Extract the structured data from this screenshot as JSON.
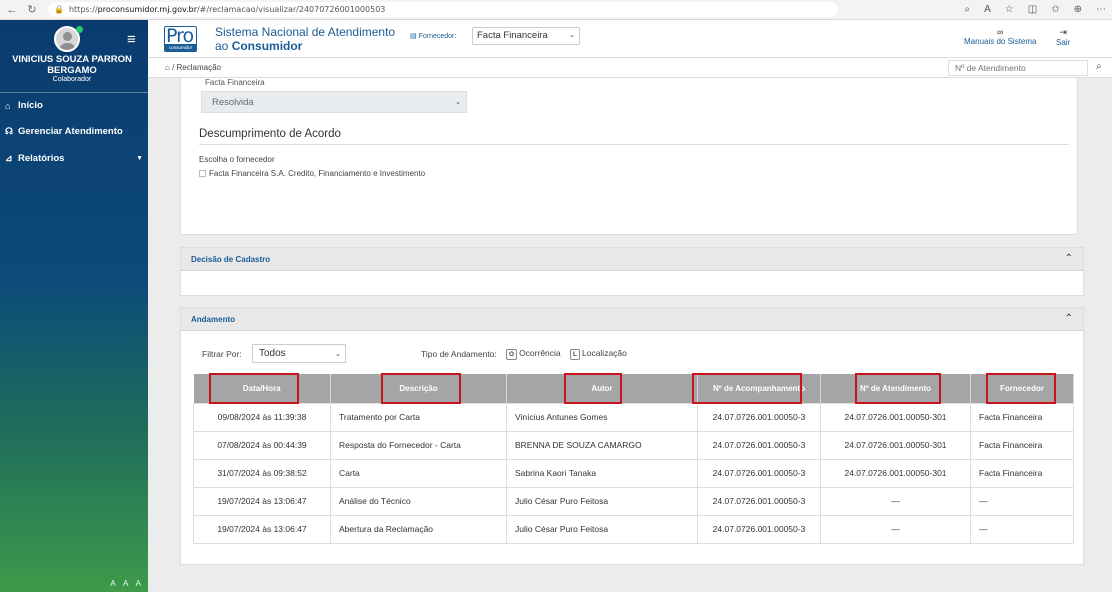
{
  "browser": {
    "url_prefix": "https://",
    "url_domain": "proconsumidor.mj.gov.br",
    "url_path": "/#/reclamacao/visualizar/24070726001000503"
  },
  "sidebar": {
    "user_name": "VINICIUS SOUZA PARRON BERGAMO",
    "user_role": "Colaborador",
    "items": [
      {
        "label": "Início",
        "icon": "home-icon"
      },
      {
        "label": "Gerenciar Atendimento",
        "icon": "headset-icon"
      },
      {
        "label": "Relatórios",
        "icon": "chart-icon"
      }
    ],
    "font_controls": "A A A"
  },
  "header": {
    "logo_text": "Pro",
    "logo_sub": "consumidor",
    "title_line1": "Sistema Nacional de Atendimento",
    "title_line2_prefix": "ao ",
    "title_line2_bold": "Consumidor",
    "fornecedor_label": "Fornecedor:",
    "fornecedor_value": "Facta Financeira",
    "manuals_label": "Manuais do Sistema",
    "exit_label": "Sair"
  },
  "breadcrumb": {
    "current": "Reclamação"
  },
  "search": {
    "placeholder": "Nº de Atendimento"
  },
  "top_card": {
    "fornecedor_small": "Facta Financeira",
    "status_value": "Resolvida",
    "section_title": "Descumprimento de Acordo",
    "choose_label": "Escolha o fornecedor",
    "checkbox_label": "Facta Financeira S.A. Credito, Financiamento e Investimento"
  },
  "decisao": {
    "title": "Decisão de Cadastro"
  },
  "andamento": {
    "title": "Andamento",
    "filter_label": "Filtrar Por:",
    "filter_value": "Todos",
    "tipo_label": "Tipo de Andamento:",
    "tipo_o_badge": "O",
    "tipo_o_label": "Ocorrência",
    "tipo_l_badge": "L",
    "tipo_l_label": "Localização",
    "columns": [
      "Data/Hora",
      "Descrição",
      "Autor",
      "Nº de Acompanhamento",
      "Nº de Atendimento",
      "Fornecedor"
    ],
    "rows": [
      [
        "09/08/2024 às 11:39:38",
        "Tratamento por Carta",
        "Vinícius Antunes Gomes",
        "24.07.0726.001.00050-3",
        "24.07.0726.001.00050-301",
        "Facta Financeira"
      ],
      [
        "07/08/2024 às 00:44:39",
        "Resposta do Fornecedor - Carta",
        "BRENNA DE SOUZA CAMARGO",
        "24.07.0726.001.00050-3",
        "24.07.0726.001.00050-301",
        "Facta Financeira"
      ],
      [
        "31/07/2024 às 09:38:52",
        "Carta",
        "Sabrina Kaori Tanaka",
        "24.07.0726.001.00050-3",
        "24.07.0726.001.00050-301",
        "Facta Financeira"
      ],
      [
        "19/07/2024 às 13:06:47",
        "Análise do Técnico",
        "Julio César Puro Feitosa",
        "24.07.0726.001.00050-3",
        "—",
        "—"
      ],
      [
        "19/07/2024 às 13:06:47",
        "Abertura da Reclamação",
        "Julio César Puro Feitosa",
        "24.07.0726.001.00050-3",
        "—",
        "—"
      ]
    ]
  }
}
